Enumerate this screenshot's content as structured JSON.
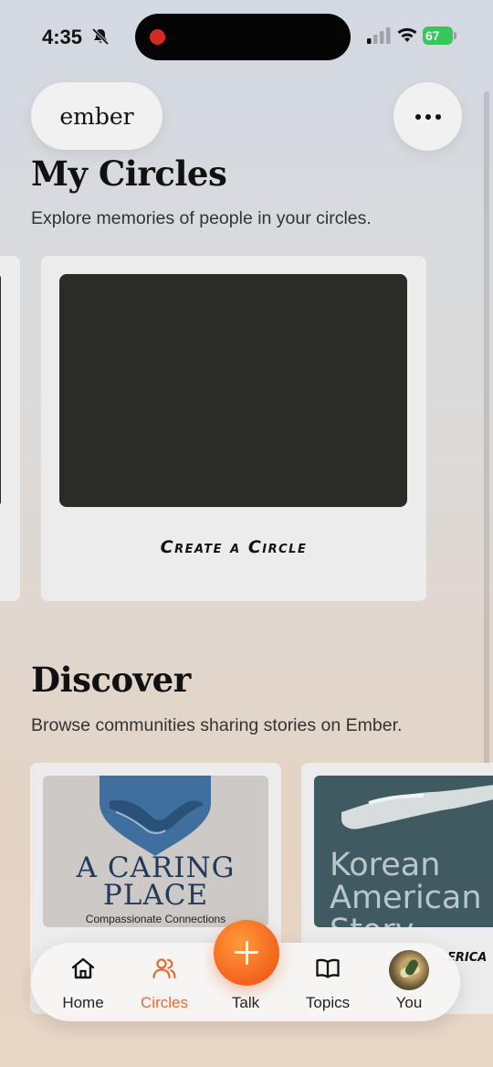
{
  "status_bar": {
    "time": "4:35",
    "battery": "67"
  },
  "header": {
    "logo": "ember",
    "more_icon": "ellipsis-icon"
  },
  "my_circles": {
    "title": "My Circles",
    "subtitle": "Explore memories of people in your circles.",
    "create_caption": "Create a Circle"
  },
  "discover": {
    "title": "Discover",
    "subtitle": "Browse communities sharing stories on Ember.",
    "cards": [
      {
        "title_line1": "A CARING",
        "title_line2": "PLACE",
        "tagline": "Compassionate Connections"
      },
      {
        "title_line1": "Korean",
        "title_line2": "American",
        "title_line3": "Story",
        "caption_peek": "erica"
      }
    ]
  },
  "tab_bar": {
    "tabs": [
      {
        "label": "Home",
        "icon": "home-icon"
      },
      {
        "label": "Circles",
        "icon": "people-icon",
        "active": true
      },
      {
        "label": "Talk",
        "icon": "plus-icon"
      },
      {
        "label": "Topics",
        "icon": "book-icon"
      },
      {
        "label": "You",
        "icon": "avatar"
      }
    ]
  },
  "colors": {
    "accent": "#e86a33",
    "fab": "#f5661e",
    "battery": "#35c759"
  }
}
